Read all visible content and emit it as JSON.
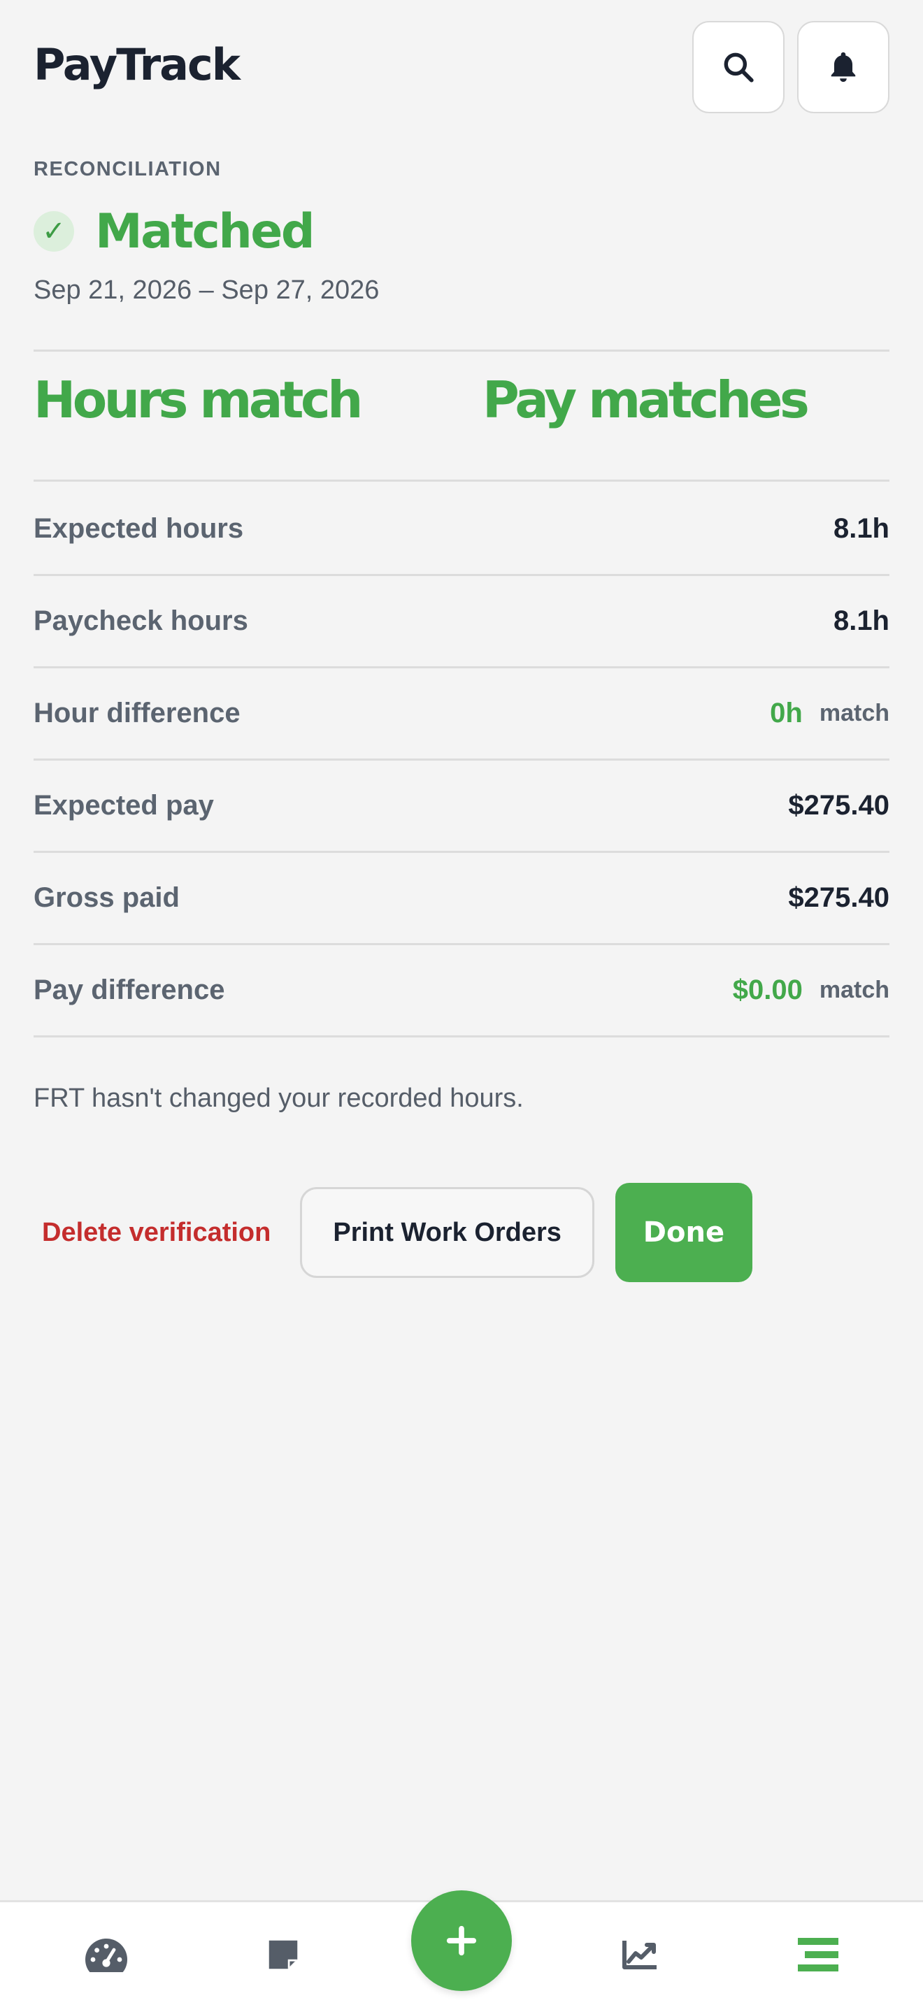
{
  "app": {
    "title": "PayTrack"
  },
  "header": {
    "icons": [
      "search-icon",
      "bell-icon"
    ]
  },
  "reconciliation": {
    "section_label": "RECONCILIATION",
    "status": "Matched",
    "status_icon": "check-icon",
    "date_range": "Sep 21, 2026 – Sep 27, 2026",
    "hours_summary": "Hours match",
    "pay_summary": "Pay matches"
  },
  "details": {
    "expected_hours": {
      "label": "Expected hours",
      "value": "8.1h"
    },
    "paycheck_hours": {
      "label": "Paycheck hours",
      "value": "8.1h"
    },
    "hour_difference": {
      "label": "Hour difference",
      "value": "0h",
      "tag": "match"
    },
    "expected_pay": {
      "label": "Expected pay",
      "value": "$275.40"
    },
    "gross_paid": {
      "label": "Gross paid",
      "value": "$275.40"
    },
    "pay_difference": {
      "label": "Pay difference",
      "value": "$0.00",
      "tag": "match"
    }
  },
  "note": "FRT hasn't changed your recorded hours.",
  "actions": {
    "delete_label": "Delete verification",
    "print_label": "Print Work Orders",
    "done_label": "Done"
  },
  "bottom_nav": {
    "items": [
      "dashboard-icon",
      "notes-icon",
      "add-icon",
      "trends-icon",
      "menu-icon"
    ],
    "active": "menu-icon"
  },
  "colors": {
    "accent_green": "#4caf50",
    "text_green": "#42a84a",
    "danger_red": "#c42d2d",
    "background": "#f4f4f4"
  }
}
